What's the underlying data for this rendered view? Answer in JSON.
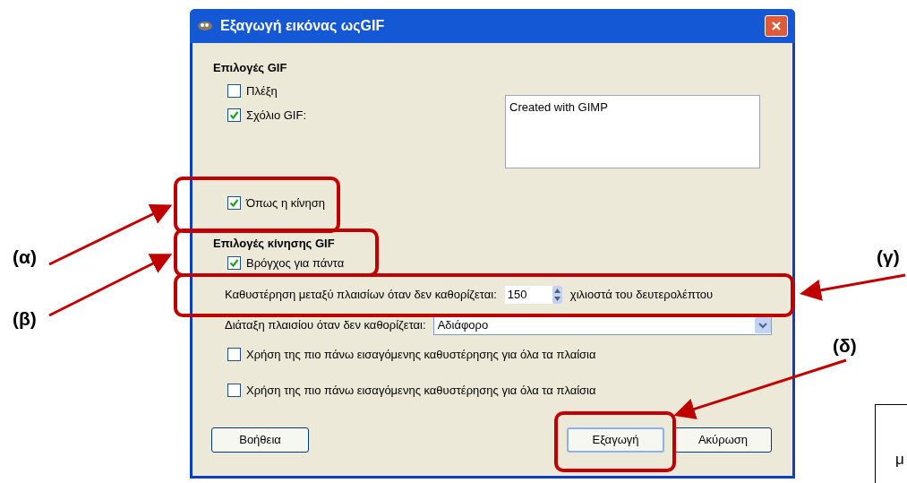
{
  "dialog": {
    "title": "Εξαγωγή εικόνας ωςGIF",
    "gif_options": {
      "heading": "Επιλογές GIF",
      "interlace": {
        "label": "Πλέξη",
        "checked": false
      },
      "comment": {
        "label": "Σχόλιο GIF:",
        "checked": true,
        "value": "Created with GIMP"
      },
      "as_animation": {
        "label": "Όπως η κίνηση",
        "checked": true
      }
    },
    "animation_options": {
      "heading": "Επιλογές κίνησης GIF",
      "loop": {
        "label": "Βρόγχος για πάντα",
        "checked": true
      },
      "delay": {
        "label": "Καθυστέρηση μεταξύ πλαισίων όταν δεν καθορίζεται:",
        "value": "150",
        "unit": "χιλιοστά του δευτερολέπτου"
      },
      "disposal": {
        "label": "Διάταξη πλαισίου όταν δεν καθορίζεται:",
        "value": "Αδιάφορο"
      },
      "checkboxes": [
        {
          "label": "Χρήση της πιο πάνω εισαγόμενης καθυστέρησης για όλα τα πλαίσια",
          "checked": false
        },
        {
          "label": "Χρήση της πιο πάνω εισαγόμενης καθυστέρησης για όλα τα πλαίσια",
          "checked": false
        }
      ]
    },
    "buttons": [
      {
        "label": "Βοήθεια",
        "default": false
      },
      {
        "label": "Εξαγωγή",
        "default": true
      },
      {
        "label": "Ακύρωση",
        "default": false
      }
    ]
  },
  "annotations": [
    {
      "label": "(α)"
    },
    {
      "label": "(β)"
    },
    {
      "label": "(γ)"
    },
    {
      "label": "(δ)"
    }
  ],
  "side_note": {
    "text": "μ"
  }
}
